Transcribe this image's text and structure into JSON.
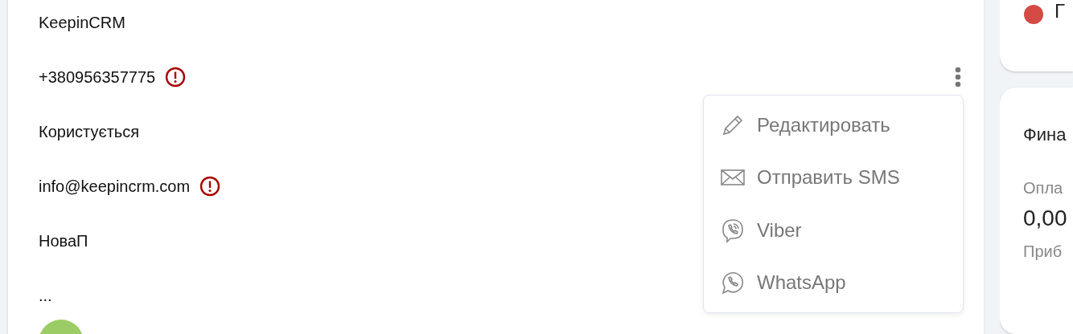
{
  "contact": {
    "fields": [
      {
        "text": "KeepinCRM",
        "warning": false
      },
      {
        "text": "+380956357775",
        "warning": true
      },
      {
        "text": "Користується",
        "warning": false
      },
      {
        "text": "info@keepincrm.com",
        "warning": true
      },
      {
        "text": "НоваП",
        "warning": false
      },
      {
        "text": "...",
        "warning": false
      }
    ]
  },
  "menu": {
    "items": [
      {
        "kind": "edit",
        "label": "Редактировать"
      },
      {
        "kind": "sms",
        "label": "Отправить SMS"
      },
      {
        "kind": "viber",
        "label": "Viber"
      },
      {
        "kind": "whatsapp",
        "label": "WhatsApp"
      }
    ]
  },
  "status_card": {
    "label": "Г"
  },
  "finance_card": {
    "title": "Фина",
    "rows": [
      {
        "label": "Опла",
        "value": "0,00"
      },
      {
        "label": "Приб"
      }
    ]
  }
}
